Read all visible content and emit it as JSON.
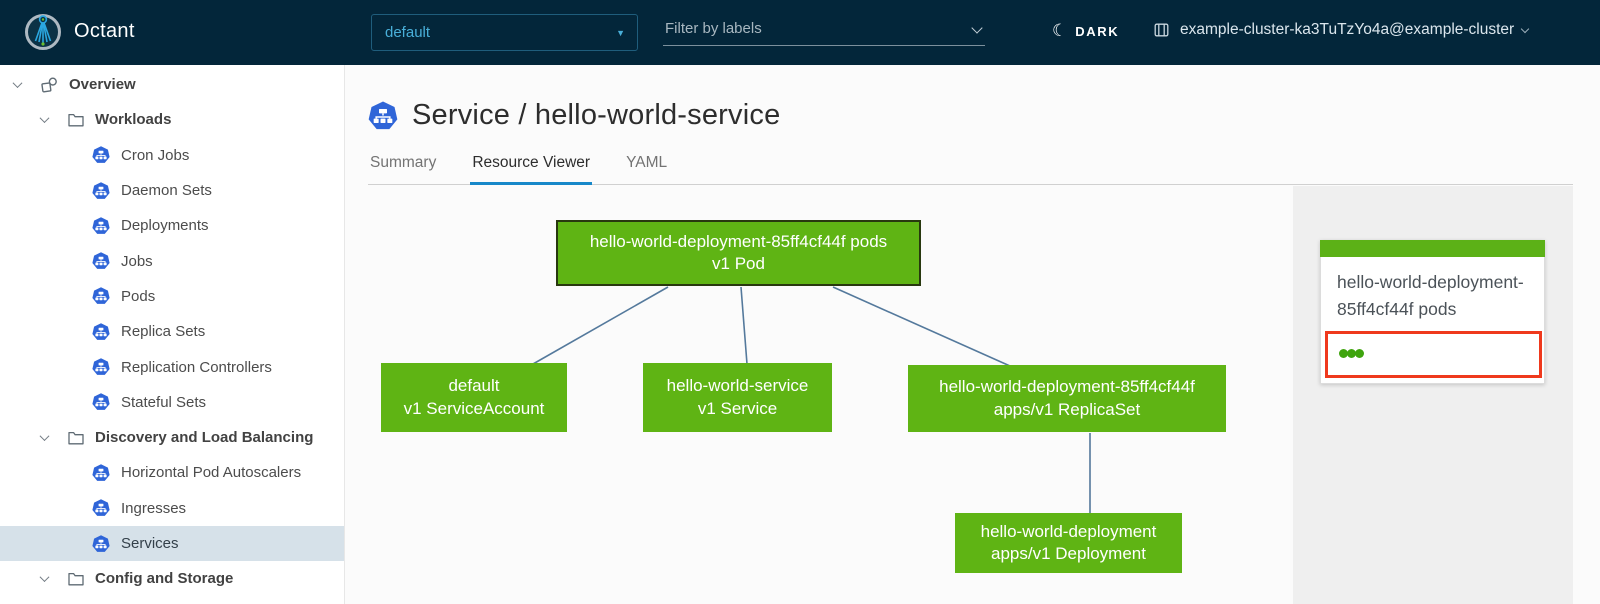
{
  "header": {
    "app_title": "Octant",
    "namespace_selector": {
      "value": "default"
    },
    "filter": {
      "placeholder": "Filter by labels"
    },
    "theme_toggle": {
      "label": "DARK"
    },
    "context": {
      "label": "example-cluster-ka3TuTzYo4a@example-cluster"
    }
  },
  "sidebar": {
    "items": [
      {
        "label": "Overview",
        "type": "root",
        "icon": "overview-icon",
        "expanded": true
      },
      {
        "label": "Workloads",
        "type": "group",
        "icon": "folder-icon",
        "expanded": true
      },
      {
        "label": "Cron Jobs",
        "type": "item",
        "icon": "cron-jobs-icon"
      },
      {
        "label": "Daemon Sets",
        "type": "item",
        "icon": "daemon-sets-icon"
      },
      {
        "label": "Deployments",
        "type": "item",
        "icon": "deployments-icon"
      },
      {
        "label": "Jobs",
        "type": "item",
        "icon": "jobs-icon"
      },
      {
        "label": "Pods",
        "type": "item",
        "icon": "pods-icon"
      },
      {
        "label": "Replica Sets",
        "type": "item",
        "icon": "replica-sets-icon"
      },
      {
        "label": "Replication Controllers",
        "type": "item",
        "icon": "replication-controllers-icon"
      },
      {
        "label": "Stateful Sets",
        "type": "item",
        "icon": "stateful-sets-icon"
      },
      {
        "label": "Discovery and Load Balancing",
        "type": "group",
        "icon": "folder-icon",
        "expanded": true
      },
      {
        "label": "Horizontal Pod Autoscalers",
        "type": "item",
        "icon": "horizontal-pod-autoscalers-icon"
      },
      {
        "label": "Ingresses",
        "type": "item",
        "icon": "ingresses-icon"
      },
      {
        "label": "Services",
        "type": "item",
        "icon": "services-icon",
        "selected": true
      },
      {
        "label": "Config and Storage",
        "type": "group",
        "icon": "folder-icon",
        "expanded": true
      }
    ]
  },
  "main": {
    "title": "Service / hello-world-service",
    "title_icon": "service-icon",
    "tabs": [
      {
        "label": "Summary",
        "active": false
      },
      {
        "label": "Resource Viewer",
        "active": true
      },
      {
        "label": "YAML",
        "active": false
      }
    ]
  },
  "graph": {
    "nodes": [
      {
        "id": "pod",
        "lines": [
          "hello-world-deployment-85ff4cf44f pods",
          "v1 Pod"
        ],
        "selected": true
      },
      {
        "id": "serviceaccount",
        "lines": [
          "default",
          "v1 ServiceAccount"
        ],
        "selected": false
      },
      {
        "id": "service",
        "lines": [
          "hello-world-service",
          "v1 Service"
        ],
        "selected": false
      },
      {
        "id": "replicaset",
        "lines": [
          "hello-world-deployment-85ff4cf44f",
          "apps/v1 ReplicaSet"
        ],
        "selected": false
      },
      {
        "id": "deployment",
        "lines": [
          "hello-world-deployment",
          "apps/v1 Deployment"
        ],
        "selected": false
      }
    ],
    "edges": [
      [
        "pod",
        "serviceaccount"
      ],
      [
        "pod",
        "service"
      ],
      [
        "pod",
        "replicaset"
      ],
      [
        "replicaset",
        "deployment"
      ]
    ]
  },
  "detail_panel": {
    "card": {
      "title": "hello-world-deployment-85ff4cf44f pods",
      "status_dots": 3
    }
  },
  "colors": {
    "header_bg": "#03263a",
    "accent_blue": "#49afd9",
    "k8s_icon_blue": "#2f65d8",
    "node_green": "#5fb414",
    "edge_blue": "#54799c",
    "tab_active_blue": "#1788c9",
    "selection_red": "#ef391d",
    "status_dot_green": "#3fa40e",
    "selected_row_bg": "#d6e1e9",
    "panel_bg": "#efefef"
  }
}
